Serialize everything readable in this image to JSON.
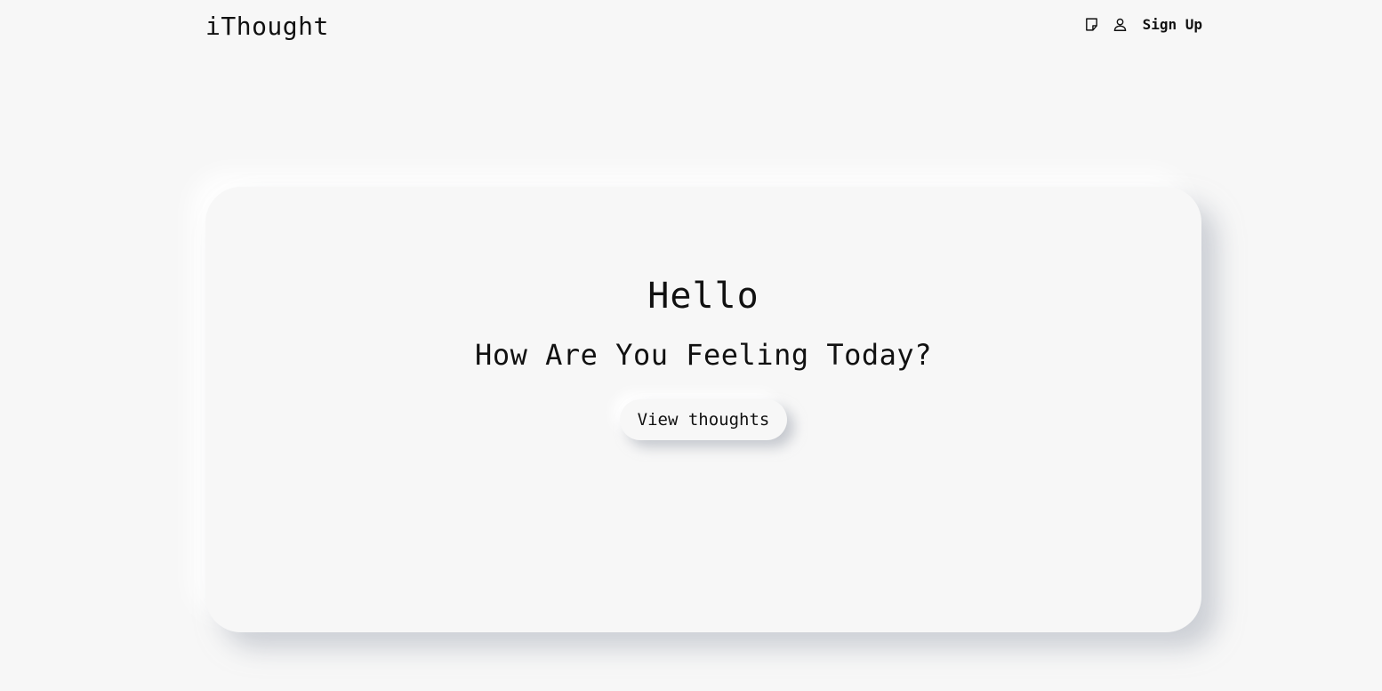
{
  "header": {
    "brand": "iThought",
    "icons": [
      "note-icon",
      "user-icon"
    ],
    "signup_label": "Sign Up"
  },
  "hero": {
    "title": "Hello",
    "subtitle": "How Are You Feeling Today?",
    "button_label": "View thoughts"
  },
  "colors": {
    "background": "#f7f7f7",
    "text": "#111111"
  }
}
